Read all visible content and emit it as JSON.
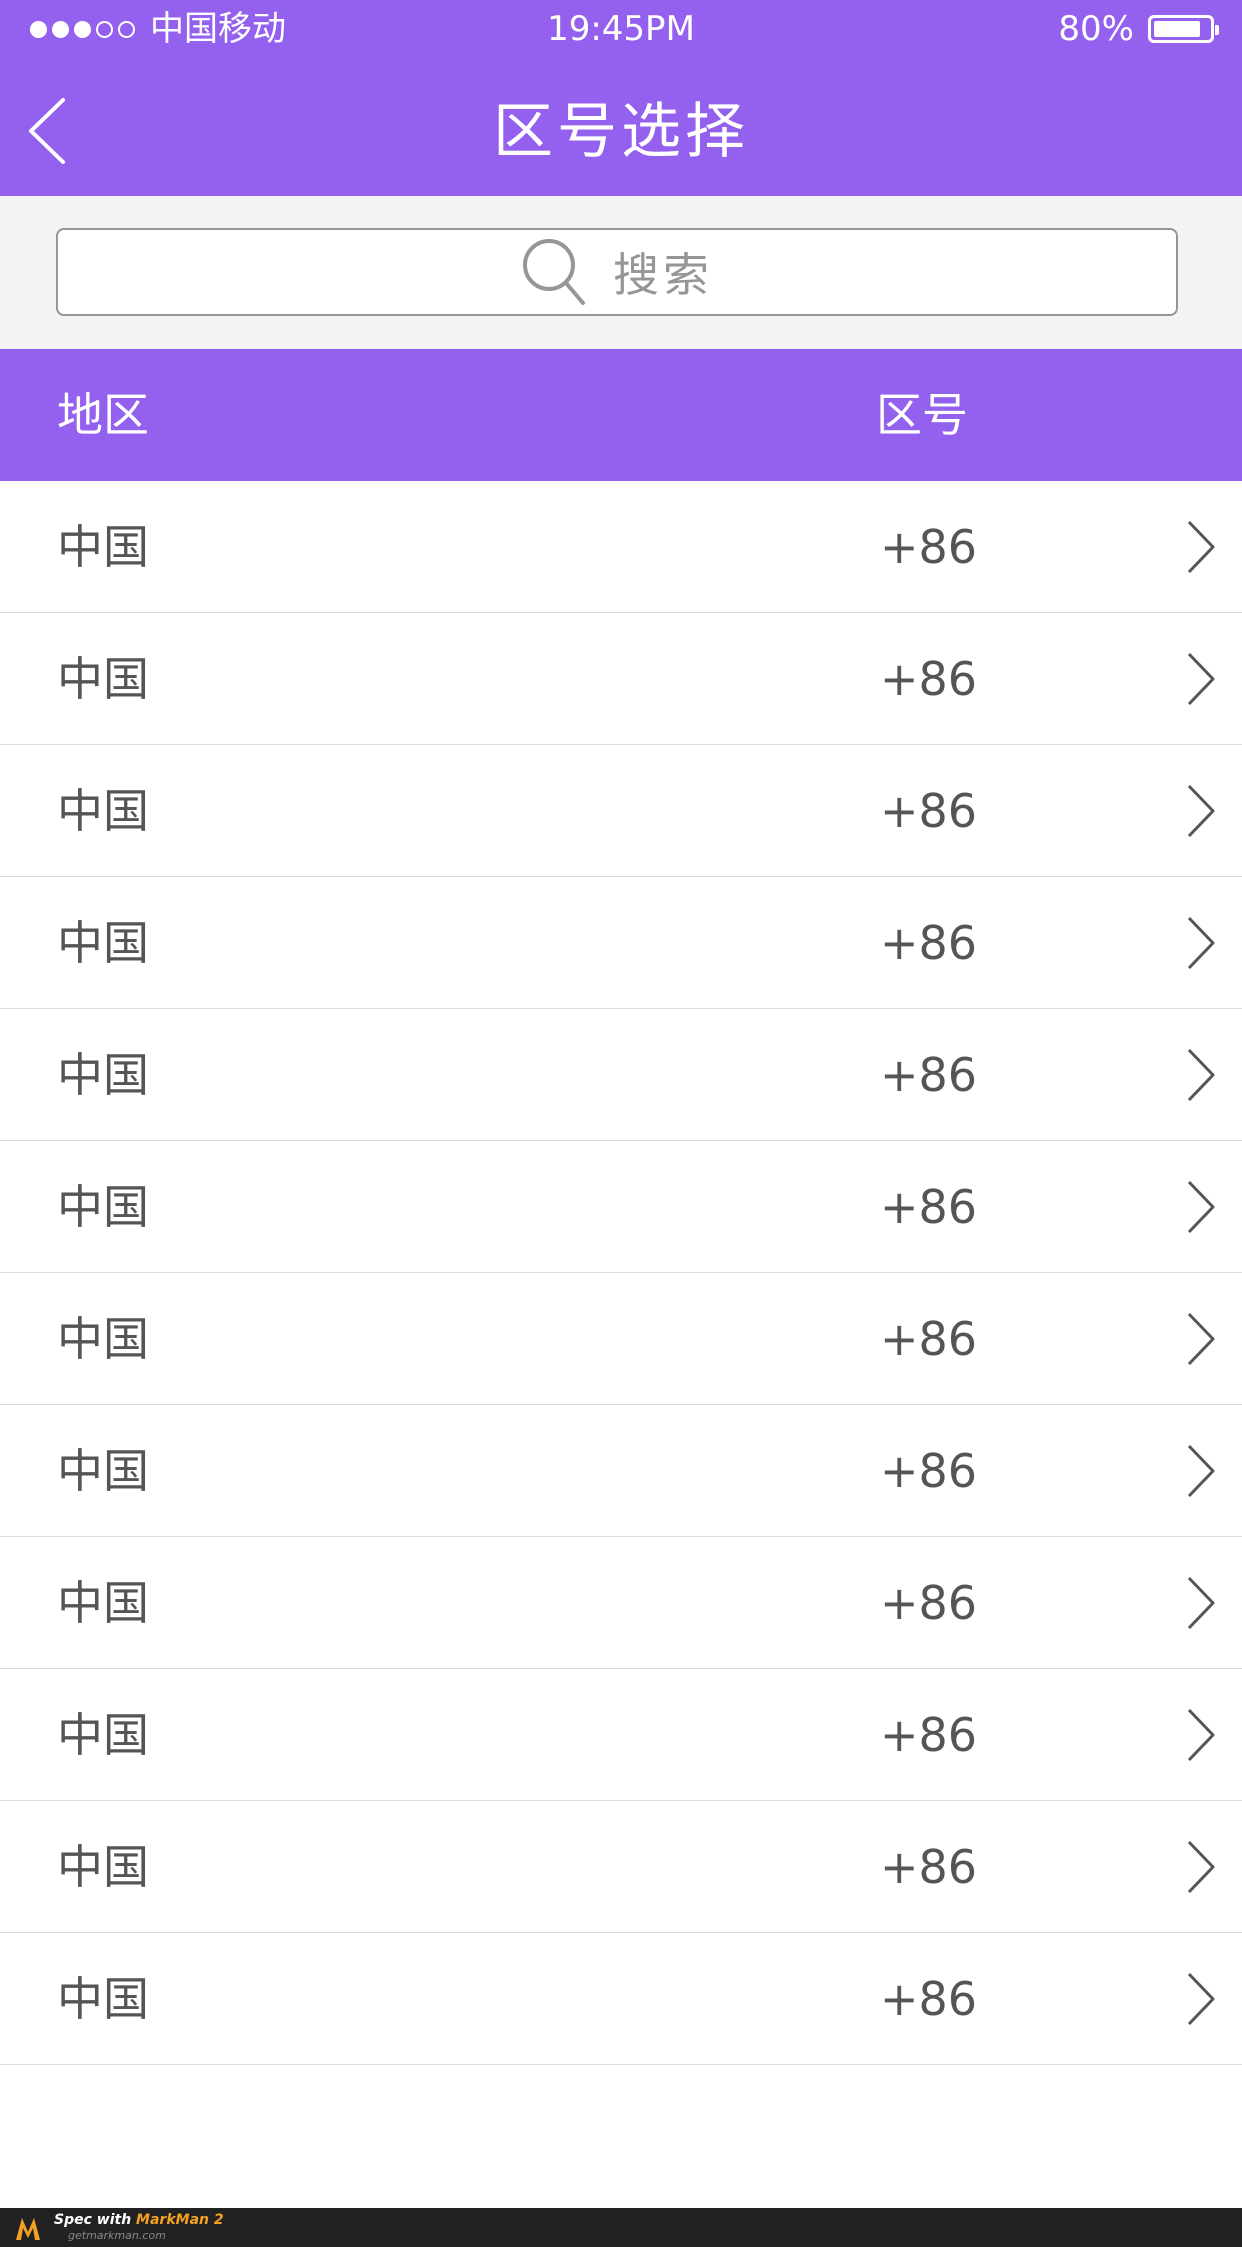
{
  "status_bar": {
    "carrier": "中国移动",
    "time": "19:45PM",
    "battery": "80%",
    "signal_strength": 3,
    "battery_level": 0.8
  },
  "nav": {
    "title": "区号选择",
    "back_icon": "chevron-left-icon"
  },
  "search": {
    "placeholder": "搜索",
    "icon": "search-icon"
  },
  "table": {
    "headers": {
      "region": "地区",
      "code": "区号"
    },
    "rows": [
      {
        "country": "中国",
        "code": "+86"
      },
      {
        "country": "中国",
        "code": "+86"
      },
      {
        "country": "中国",
        "code": "+86"
      },
      {
        "country": "中国",
        "code": "+86"
      },
      {
        "country": "中国",
        "code": "+86"
      },
      {
        "country": "中国",
        "code": "+86"
      },
      {
        "country": "中国",
        "code": "+86"
      },
      {
        "country": "中国",
        "code": "+86"
      },
      {
        "country": "中国",
        "code": "+86"
      },
      {
        "country": "中国",
        "code": "+86"
      },
      {
        "country": "中国",
        "code": "+86"
      },
      {
        "country": "中国",
        "code": "+86"
      }
    ]
  },
  "footer": {
    "spec_prefix": "Spec with",
    "brand": "MarkMan 2",
    "site": "getmarkman.com"
  },
  "colors": {
    "accent": "#9461ee",
    "search_border": "#969696",
    "divider": "#dcdcdc",
    "background": "#f3f3f3"
  }
}
